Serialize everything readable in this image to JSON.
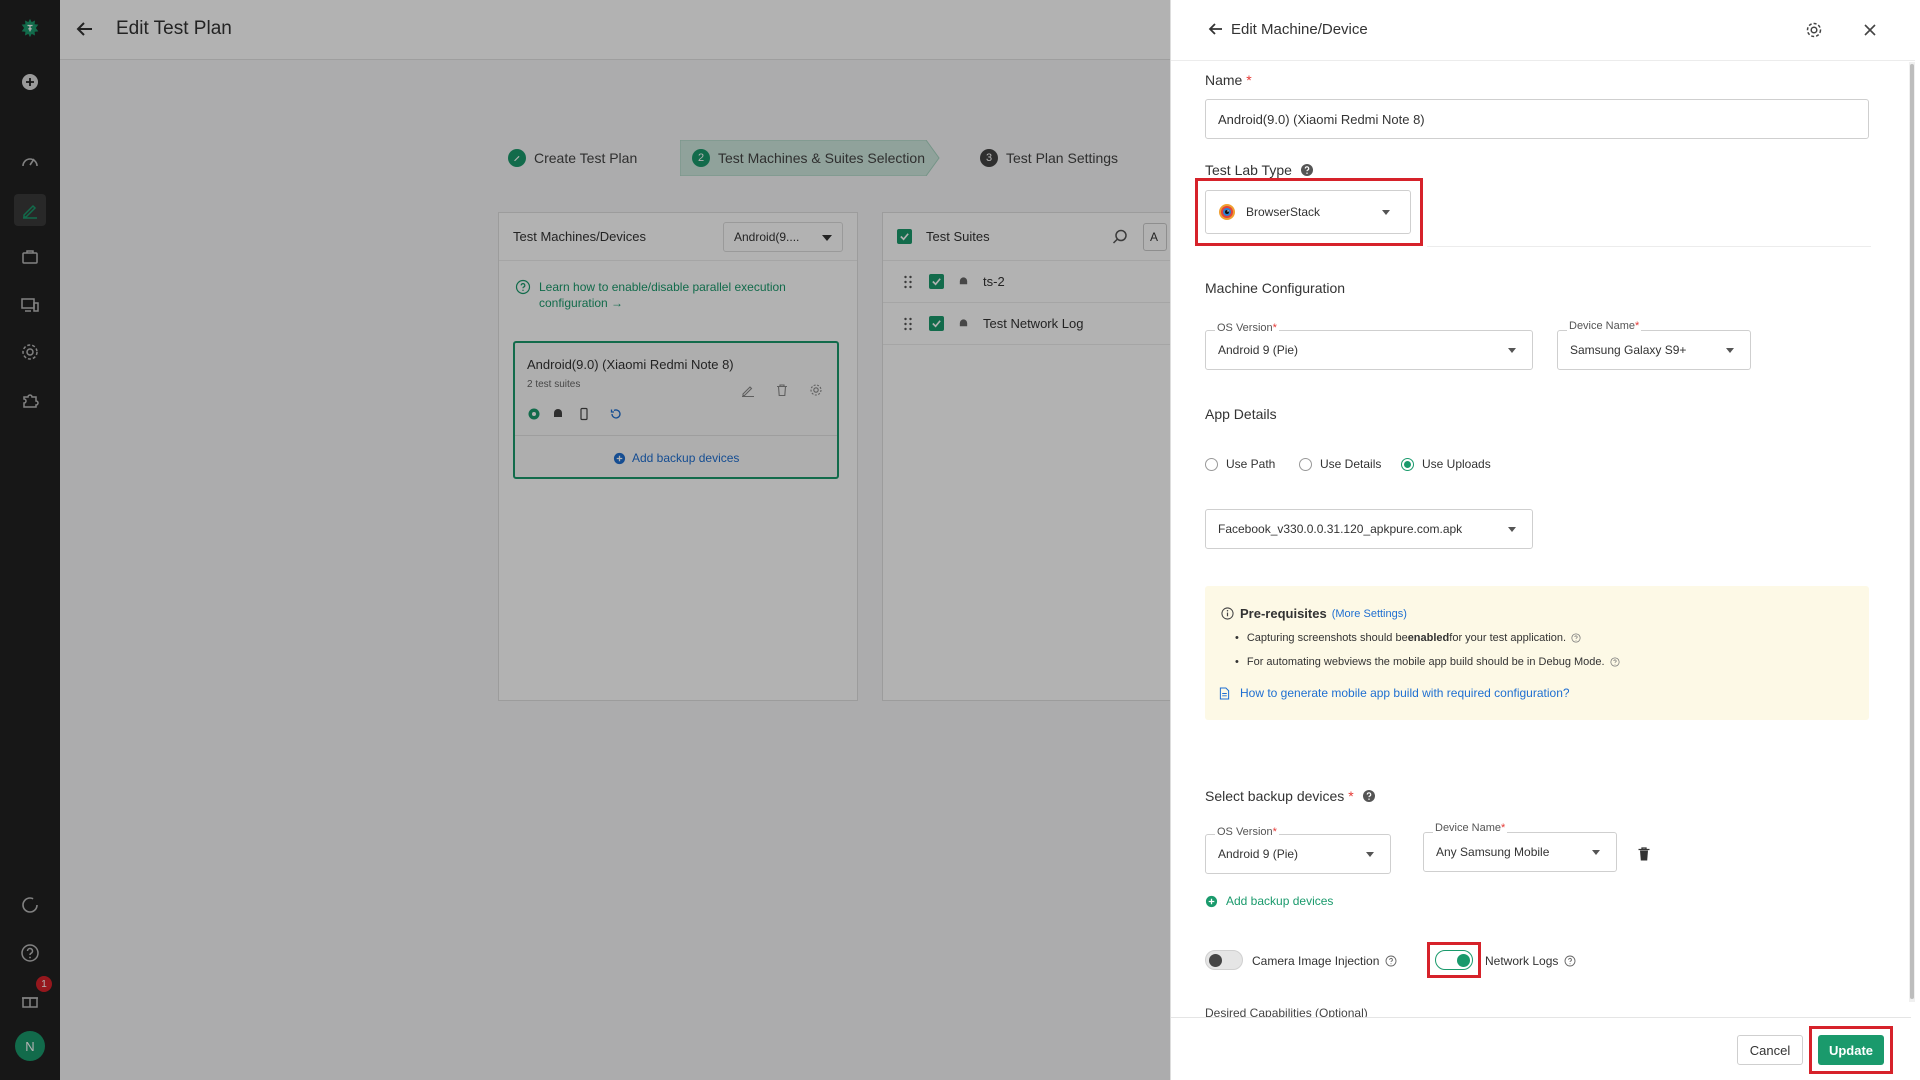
{
  "nav": {
    "badge_count": "1",
    "avatar_initial": "N"
  },
  "page": {
    "title": "Edit Test Plan"
  },
  "steps": [
    {
      "label": "Create Test Plan"
    },
    {
      "num": "2",
      "label": "Test Machines & Suites Selection"
    },
    {
      "num": "3",
      "label": "Test Plan Settings"
    }
  ],
  "machines_panel": {
    "title": "Test Machines/Devices",
    "dropdown_value": "Android(9....",
    "learn_link": "Learn how to enable/disable parallel execution configuration →",
    "card": {
      "title": "Android(9.0) (Xiaomi Redmi Note 8)",
      "subtitle": "2 test suites",
      "add_backup": "Add backup devices"
    }
  },
  "suites_panel": {
    "title": "Test Suites",
    "search_stub": "A",
    "items": [
      {
        "name": "ts-2"
      },
      {
        "name": "Test Network Log"
      }
    ]
  },
  "drawer": {
    "title": "Edit Machine/Device",
    "name_label": "Name",
    "name_value": "Android(9.0) (Xiaomi Redmi Note 8)",
    "test_lab_label": "Test Lab Type",
    "test_lab_value": "BrowserStack",
    "machine_config_label": "Machine Configuration",
    "os_version_label": "OS Version",
    "os_version_value": "Android 9 (Pie)",
    "device_name_label": "Device Name",
    "device_name_value": "Samsung Galaxy S9+",
    "app_details_label": "App Details",
    "radio_use_path": "Use Path",
    "radio_use_details": "Use Details",
    "radio_use_uploads": "Use Uploads",
    "upload_value": "Facebook_v330.0.0.31.120_apkpure.com.apk",
    "prereq_title": "Pre-requisites",
    "prereq_more": "(More Settings)",
    "prereq_items": [
      {
        "before": "Capturing screenshots should be ",
        "bold": "enabled",
        "after": " for your test application."
      },
      {
        "before": "For automating webviews the mobile app build should be in Debug Mode.",
        "bold": "",
        "after": ""
      }
    ],
    "prereq_link": "How to generate mobile app build with required configuration?",
    "backup_label": "Select backup devices",
    "backup_os_label": "OS Version",
    "backup_os_value": "Android 9 (Pie)",
    "backup_device_label": "Device Name",
    "backup_device_value": "Any Samsung Mobile",
    "add_backup": "Add backup devices",
    "camera_label": "Camera Image Injection",
    "network_label": "Network Logs",
    "desired_caps": "Desired Capabilities (Optional)",
    "cancel": "Cancel",
    "update": "Update"
  },
  "colors": {
    "brand_green": "#1a9a6c",
    "highlight_red": "#d6222a",
    "nav_bg": "#222222"
  }
}
